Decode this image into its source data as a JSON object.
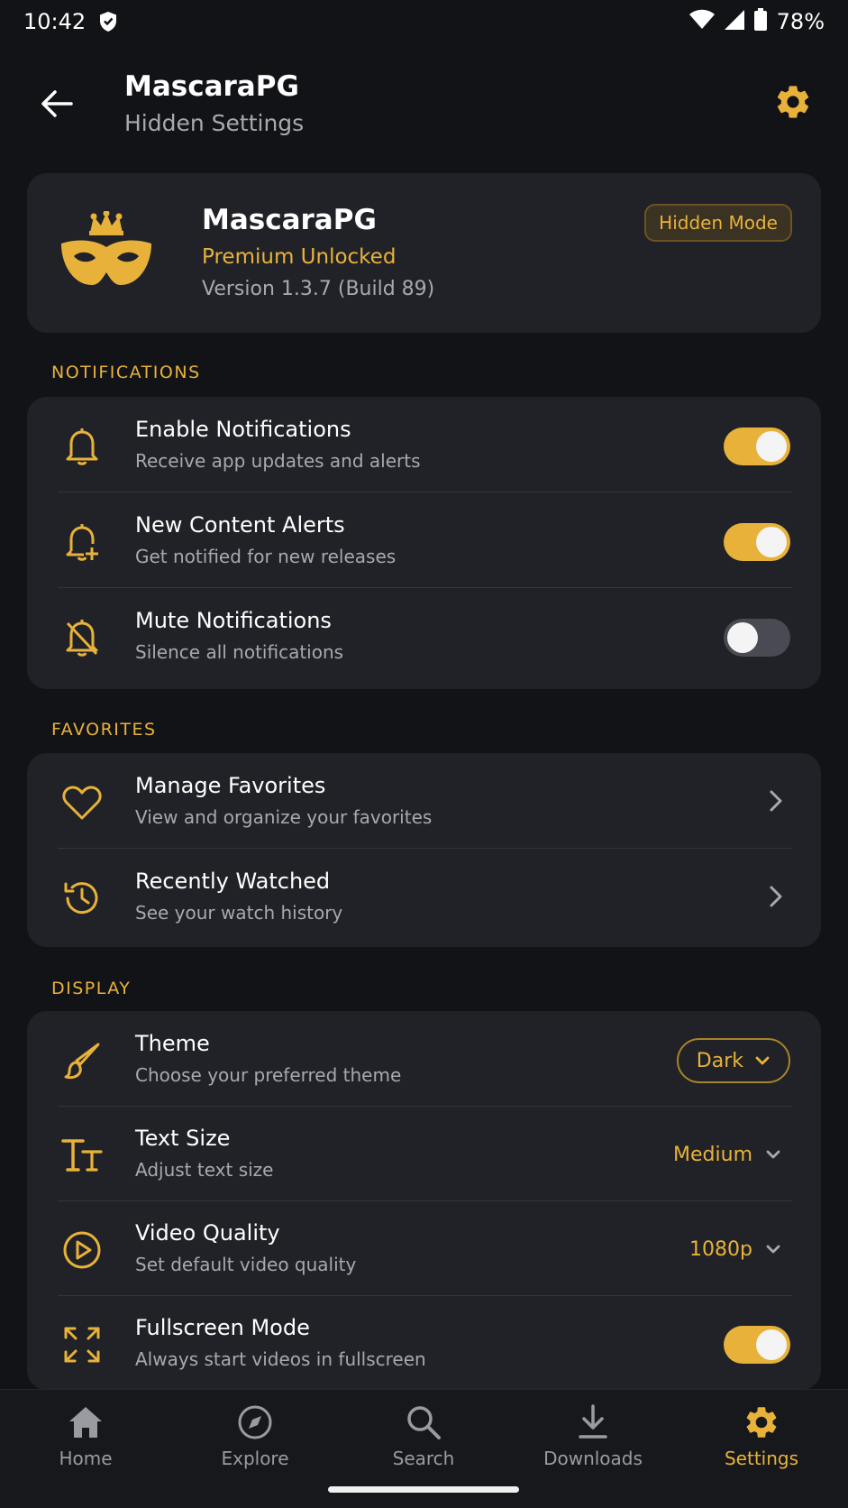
{
  "status_bar": {
    "time": "10:42",
    "battery": "78%"
  },
  "header": {
    "title": "MascaraPG",
    "subtitle": "Hidden Settings"
  },
  "profile": {
    "name": "MascaraPG",
    "status": "Premium Unlocked",
    "version": "Version 1.3.7 (Build 89)",
    "badge": "Hidden Mode"
  },
  "sections": {
    "notifications": {
      "header": "NOTIFICATIONS",
      "items": [
        {
          "title": "Enable Notifications",
          "subtitle": "Receive app updates and alerts",
          "enabled": true
        },
        {
          "title": "New Content Alerts",
          "subtitle": "Get notified for new releases",
          "enabled": true
        },
        {
          "title": "Mute Notifications",
          "subtitle": "Silence all notifications",
          "enabled": false
        }
      ]
    },
    "favorites": {
      "header": "FAVORITES",
      "items": [
        {
          "title": "Manage Favorites",
          "subtitle": "View and organize your favorites"
        },
        {
          "title": "Recently Watched",
          "subtitle": "See your watch history"
        }
      ]
    },
    "display": {
      "header": "DISPLAY",
      "items": [
        {
          "title": "Theme",
          "subtitle": "Choose your preferred theme",
          "value": "Dark"
        },
        {
          "title": "Text Size",
          "subtitle": "Adjust text size",
          "value": "Medium"
        },
        {
          "title": "Video Quality",
          "subtitle": "Set default video quality",
          "value": "1080p"
        },
        {
          "title": "Fullscreen Mode",
          "subtitle": "Always start videos in fullscreen",
          "enabled": true
        }
      ]
    }
  },
  "bottom_nav": {
    "items": [
      {
        "label": "Home",
        "icon": "home-icon"
      },
      {
        "label": "Explore",
        "icon": "compass-icon"
      },
      {
        "label": "Search",
        "icon": "search-icon"
      },
      {
        "label": "Downloads",
        "icon": "download-icon"
      },
      {
        "label": "Settings",
        "icon": "gear-icon"
      }
    ],
    "active": "Settings"
  },
  "colors": {
    "accent": "#e8b23a",
    "background": "#121317",
    "card": "#212227",
    "muted_text": "#a8a9ae"
  }
}
